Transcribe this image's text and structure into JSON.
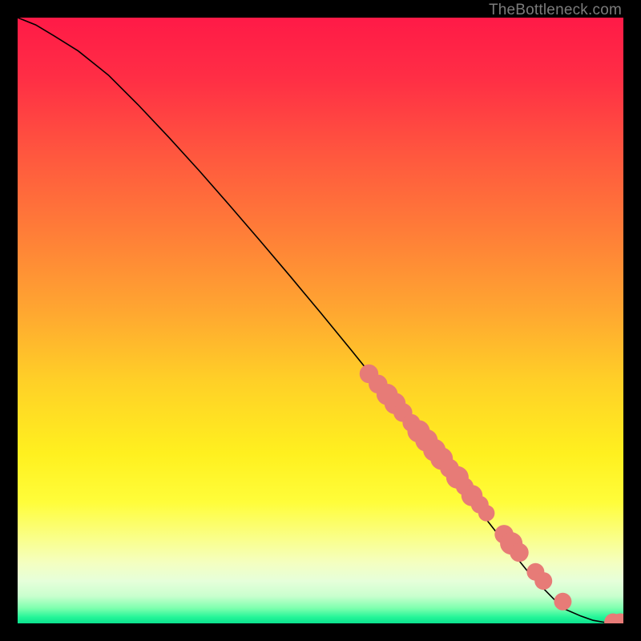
{
  "attribution": "TheBottleneck.com",
  "colors": {
    "gradient_stops": [
      {
        "offset": 0.0,
        "color": "#ff1a47"
      },
      {
        "offset": 0.1,
        "color": "#ff2e45"
      },
      {
        "offset": 0.22,
        "color": "#ff553f"
      },
      {
        "offset": 0.35,
        "color": "#ff7c38"
      },
      {
        "offset": 0.48,
        "color": "#ffa531"
      },
      {
        "offset": 0.6,
        "color": "#ffd027"
      },
      {
        "offset": 0.72,
        "color": "#fff01f"
      },
      {
        "offset": 0.8,
        "color": "#fffd3a"
      },
      {
        "offset": 0.86,
        "color": "#faff8a"
      },
      {
        "offset": 0.9,
        "color": "#f4ffc0"
      },
      {
        "offset": 0.93,
        "color": "#e6ffda"
      },
      {
        "offset": 0.955,
        "color": "#c9ffce"
      },
      {
        "offset": 0.975,
        "color": "#7dffae"
      },
      {
        "offset": 0.99,
        "color": "#23f598"
      },
      {
        "offset": 1.0,
        "color": "#0be08e"
      }
    ],
    "curve": "#000000",
    "marker_fill": "#e77b77",
    "marker_stroke": "#d8615d"
  },
  "chart_data": {
    "type": "line",
    "title": "",
    "xlabel": "",
    "ylabel": "",
    "xlim": [
      0,
      100
    ],
    "ylim": [
      0,
      100
    ],
    "series": [
      {
        "name": "bottleneck-curve",
        "x": [
          0,
          3,
          6,
          10,
          15,
          20,
          25,
          30,
          35,
          40,
          45,
          50,
          55,
          60,
          65,
          70,
          75,
          80,
          85,
          90,
          93,
          95,
          97,
          98.5,
          100
        ],
        "y": [
          100,
          98.8,
          97.0,
          94.5,
          90.5,
          85.5,
          80.2,
          74.7,
          69.0,
          63.2,
          57.3,
          51.3,
          45.2,
          39.0,
          32.8,
          26.5,
          20.2,
          13.8,
          7.6,
          2.5,
          1.2,
          0.5,
          0.15,
          0.05,
          0.0
        ]
      }
    ],
    "markers": [
      {
        "x": 58.0,
        "y": 41.2,
        "r": 1.0
      },
      {
        "x": 59.5,
        "y": 39.5,
        "r": 1.0
      },
      {
        "x": 61.0,
        "y": 37.8,
        "r": 1.2
      },
      {
        "x": 62.3,
        "y": 36.3,
        "r": 1.2
      },
      {
        "x": 63.6,
        "y": 34.8,
        "r": 1.0
      },
      {
        "x": 65.0,
        "y": 33.1,
        "r": 0.9
      },
      {
        "x": 66.2,
        "y": 31.7,
        "r": 1.3
      },
      {
        "x": 67.5,
        "y": 30.2,
        "r": 1.3
      },
      {
        "x": 68.8,
        "y": 28.6,
        "r": 1.3
      },
      {
        "x": 70.0,
        "y": 27.2,
        "r": 1.3
      },
      {
        "x": 71.3,
        "y": 25.6,
        "r": 1.0
      },
      {
        "x": 72.6,
        "y": 24.1,
        "r": 1.3
      },
      {
        "x": 73.8,
        "y": 22.6,
        "r": 0.9
      },
      {
        "x": 75.0,
        "y": 21.1,
        "r": 1.2
      },
      {
        "x": 76.3,
        "y": 19.6,
        "r": 0.9
      },
      {
        "x": 77.4,
        "y": 18.2,
        "r": 0.8
      },
      {
        "x": 80.3,
        "y": 14.7,
        "r": 1.0
      },
      {
        "x": 81.5,
        "y": 13.2,
        "r": 1.3
      },
      {
        "x": 82.8,
        "y": 11.7,
        "r": 1.0
      },
      {
        "x": 85.5,
        "y": 8.5,
        "r": 0.9
      },
      {
        "x": 86.8,
        "y": 7.0,
        "r": 0.9
      },
      {
        "x": 90.0,
        "y": 3.6,
        "r": 0.9
      },
      {
        "x": 98.3,
        "y": 0.2,
        "r": 0.9
      },
      {
        "x": 99.5,
        "y": 0.1,
        "r": 1.0
      }
    ]
  }
}
